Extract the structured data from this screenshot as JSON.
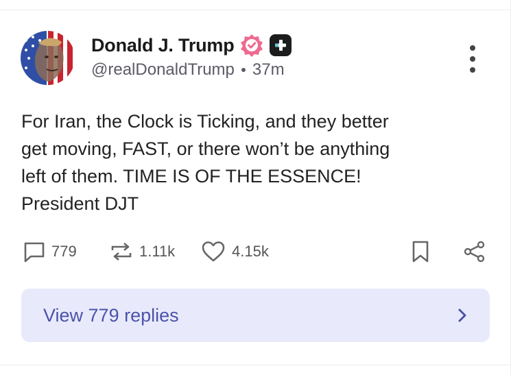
{
  "post": {
    "author_name": "Donald J. Trump",
    "handle": "@realDonaldTrump",
    "time_ago": "37m",
    "text": "For Iran, the Clock is Ticking, and they better\nget moving, FAST, or there won’t be anything\nleft of them. TIME IS OF THE ESSENCE!\nPresident DJT"
  },
  "stats": {
    "replies": "779",
    "reposts": "1.11k",
    "likes": "4.15k"
  },
  "replies_button": {
    "label": "View 779 replies"
  },
  "colors": {
    "verified_badge": "#ee6a8f",
    "accent_text": "#4b52a8",
    "replies_bg": "#e8eafc"
  },
  "icons": [
    "verified-icon",
    "plus-badge-icon",
    "more-icon",
    "comment-icon",
    "repost-icon",
    "heart-icon",
    "bookmark-icon",
    "share-icon",
    "chevron-right-icon"
  ]
}
